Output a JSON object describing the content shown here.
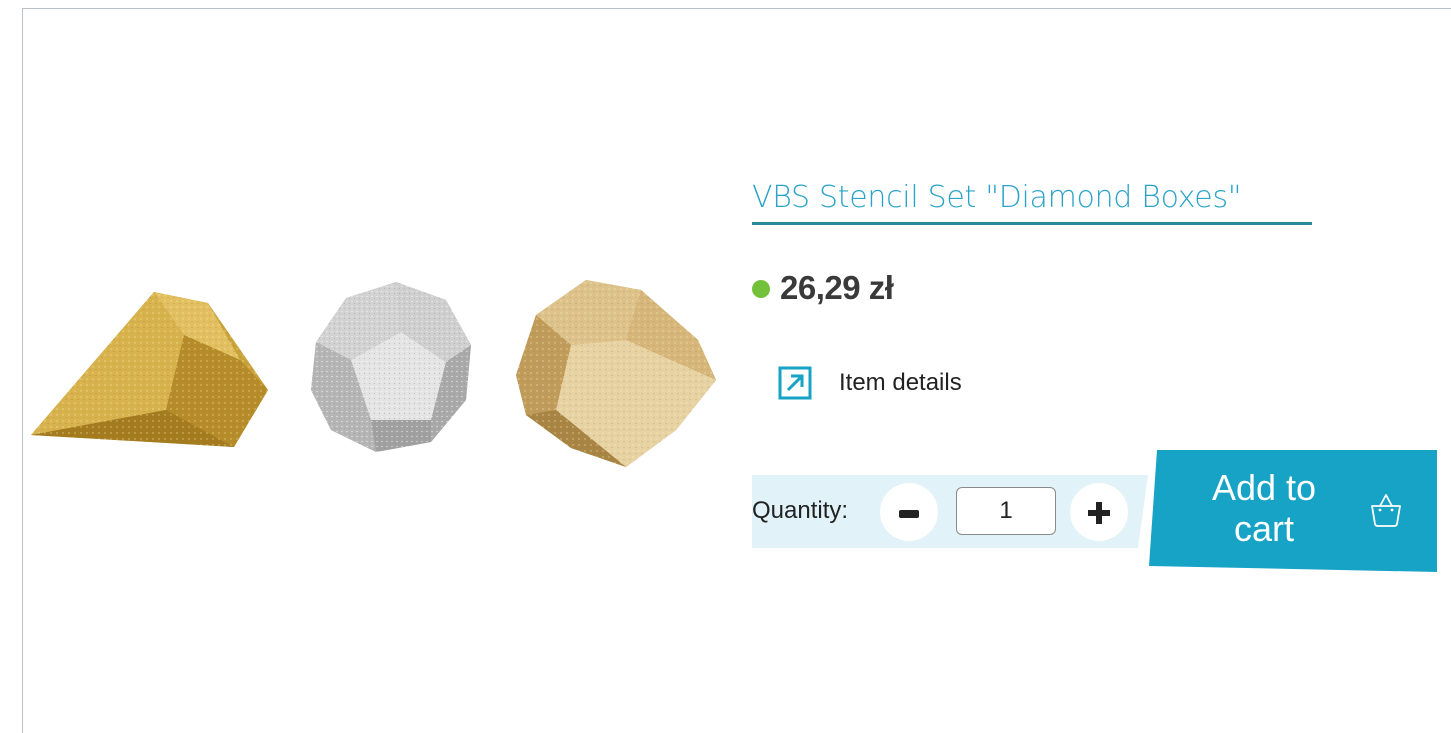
{
  "product": {
    "title": "VBS Stencil Set \"Diamond Boxes\"",
    "price": "26,29 zł",
    "availability_color": "#73c13b",
    "image_icon": "diamond-boxes-product-image"
  },
  "details": {
    "label": "Item details",
    "icon": "external-link-arrow-icon"
  },
  "quantity": {
    "label": "Quantity:",
    "value": "1",
    "decrease_icon": "minus-icon",
    "increase_icon": "plus-icon"
  },
  "cart": {
    "label": "Add to cart",
    "icon": "basket-icon"
  },
  "colors": {
    "link": "#2aa3c8",
    "accent": "#16a3c6",
    "panel": "#e1f3f8",
    "underline": "#2a8a97"
  }
}
